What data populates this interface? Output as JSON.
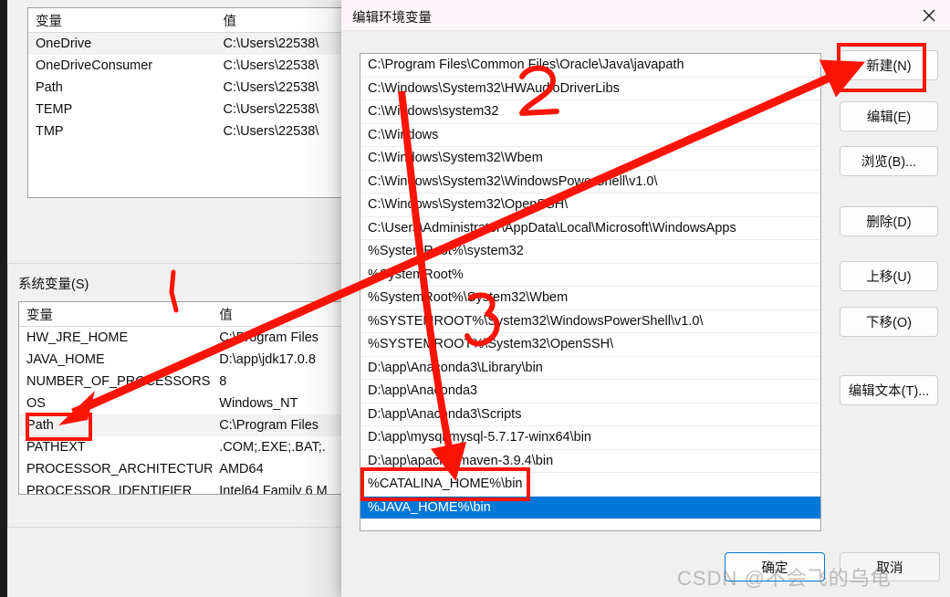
{
  "background_window": {
    "user_variables": {
      "columns": [
        "变量",
        "值"
      ],
      "rows": [
        {
          "name": "OneDrive",
          "value": "C:\\Users\\22538\\"
        },
        {
          "name": "OneDriveConsumer",
          "value": "C:\\Users\\22538\\"
        },
        {
          "name": "Path",
          "value": "C:\\Users\\22538\\"
        },
        {
          "name": "TEMP",
          "value": "C:\\Users\\22538\\"
        },
        {
          "name": "TMP",
          "value": "C:\\Users\\22538\\"
        }
      ]
    },
    "system_variables": {
      "group_label": "系统变量(S)",
      "columns": [
        "变量",
        "值"
      ],
      "rows": [
        {
          "name": "HW_JRE_HOME",
          "value": "C:\\Program Files"
        },
        {
          "name": "JAVA_HOME",
          "value": "D:\\app\\jdk17.0.8"
        },
        {
          "name": "NUMBER_OF_PROCESSORS",
          "value": "8"
        },
        {
          "name": "OS",
          "value": "Windows_NT"
        },
        {
          "name": "Path",
          "value": "C:\\Program Files"
        },
        {
          "name": "PATHEXT",
          "value": ".COM;.EXE;.BAT;."
        },
        {
          "name": "PROCESSOR_ARCHITECTURE",
          "value": "AMD64"
        },
        {
          "name": "PROCESSOR_IDENTIFIER",
          "value": "Intel64 Family 6 M"
        }
      ]
    }
  },
  "dialog": {
    "title": "编辑环境变量",
    "close_icon": "close-icon",
    "path_entries": [
      "C:\\Program Files\\Common Files\\Oracle\\Java\\javapath",
      "C:\\Windows\\System32\\HWAudioDriverLibs",
      "C:\\Windows\\system32",
      "C:\\Windows",
      "C:\\Windows\\System32\\Wbem",
      "C:\\Windows\\System32\\WindowsPowerShell\\v1.0\\",
      "C:\\Windows\\System32\\OpenSSH\\",
      "C:\\Users\\Administrator\\AppData\\Local\\Microsoft\\WindowsApps",
      "%SystemRoot%\\system32",
      "%SystemRoot%",
      "%SystemRoot%\\System32\\Wbem",
      "%SYSTEMROOT%\\System32\\WindowsPowerShell\\v1.0\\",
      "%SYSTEMROOT%\\System32\\OpenSSH\\",
      "D:\\app\\Anaconda3\\Library\\bin",
      "D:\\app\\Anaconda3",
      "D:\\app\\Anaconda3\\Scripts",
      "D:\\app\\mysql\\mysql-5.7.17-winx64\\bin",
      "D:\\app\\apache-maven-3.9.4\\bin",
      "%CATALINA_HOME%\\bin",
      "%JAVA_HOME%\\bin"
    ],
    "selected_entry_index": 19,
    "buttons": {
      "new": {
        "text": "新建(N)",
        "accel": "N"
      },
      "edit": {
        "text": "编辑(E)",
        "accel": "E"
      },
      "browse": {
        "text": "浏览(B)...",
        "accel": "B"
      },
      "delete": {
        "text": "删除(D)",
        "accel": "D"
      },
      "move_up": {
        "text": "上移(U)",
        "accel": "U"
      },
      "move_down": {
        "text": "下移(O)",
        "accel": "O"
      },
      "edit_text": {
        "text": "编辑文本(T)...",
        "accel": "T"
      },
      "ok": {
        "text": "确定"
      },
      "cancel": {
        "text": "取消"
      }
    }
  },
  "annotations": {
    "step_1": "1",
    "step_2": "2",
    "step_3": "3",
    "color": "#fb1405",
    "highlight_path_row": "Path",
    "highlight_entry": "%JAVA_HOME%\\bin",
    "highlight_button": "新建(N)"
  },
  "watermark": {
    "text": "CSDN @不会飞的乌龟"
  }
}
